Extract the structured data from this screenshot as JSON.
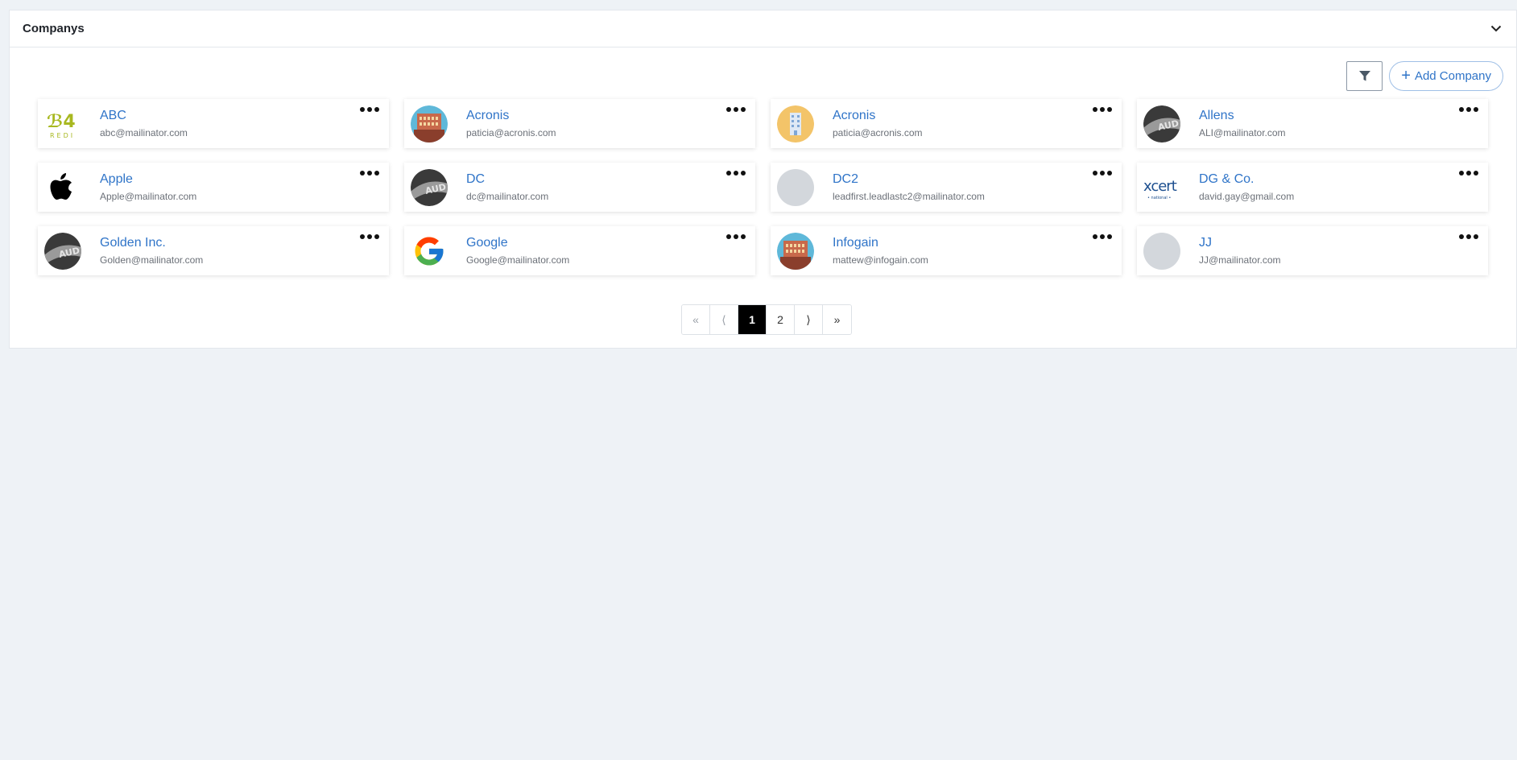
{
  "panel": {
    "title": "Companys"
  },
  "toolbar": {
    "add_label": "Add Company",
    "plus": "+"
  },
  "companies": [
    {
      "name": "ABC",
      "email": "abc@mailinator.com",
      "logo": "abc-logo"
    },
    {
      "name": "Acronis",
      "email": "paticia@acronis.com",
      "logo": "building-red-icon"
    },
    {
      "name": "Acronis",
      "email": "paticia@acronis.com",
      "logo": "building-blue-icon"
    },
    {
      "name": "Allens",
      "email": "ALI@mailinator.com",
      "logo": "audi-car-icon"
    },
    {
      "name": "Apple",
      "email": "Apple@mailinator.com",
      "logo": "apple-logo"
    },
    {
      "name": "DC",
      "email": "dc@mailinator.com",
      "logo": "audi-car-icon"
    },
    {
      "name": "DC2",
      "email": "leadfirst.leadlastc2@mailinator.com",
      "logo": "blank-avatar"
    },
    {
      "name": "DG & Co.",
      "email": "david.gay@gmail.com",
      "logo": "xcert-logo"
    },
    {
      "name": "Golden Inc.",
      "email": "Golden@mailinator.com",
      "logo": "audi-car-icon"
    },
    {
      "name": "Google",
      "email": "Google@mailinator.com",
      "logo": "google-logo"
    },
    {
      "name": "Infogain",
      "email": "mattew@infogain.com",
      "logo": "building-red-icon"
    },
    {
      "name": "JJ",
      "email": "JJ@mailinator.com",
      "logo": "blank-avatar"
    }
  ],
  "pagination": {
    "first": "«",
    "prev": "⟨",
    "pages": [
      "1",
      "2"
    ],
    "current": "1",
    "next": "⟩",
    "last": "»"
  },
  "colors": {
    "link": "#2f74c8",
    "background": "#eef2f6",
    "active_page": "#000000"
  }
}
